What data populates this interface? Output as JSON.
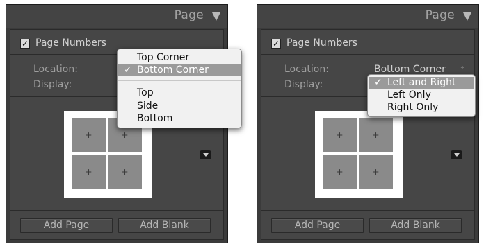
{
  "left": {
    "panel_title": "Page",
    "page_numbers_label": "Page Numbers",
    "page_numbers_checked": "✓",
    "location_label": "Location:",
    "display_label": "Display:",
    "location_menu": {
      "items": [
        {
          "label": "Top Corner",
          "check": ""
        },
        {
          "label": "Bottom Corner",
          "check": "✓"
        },
        {
          "label": "Top",
          "check": ""
        },
        {
          "label": "Side",
          "check": ""
        },
        {
          "label": "Bottom",
          "check": ""
        }
      ]
    },
    "grid_cells": [
      "+",
      "+",
      "+",
      "+"
    ],
    "add_page_label": "Add Page",
    "add_blank_label": "Add Blank"
  },
  "right": {
    "panel_title": "Page",
    "page_numbers_label": "Page Numbers",
    "page_numbers_checked": "✓",
    "location_label": "Location:",
    "display_label": "Display:",
    "location_value": "Bottom Corner",
    "location_arrows": "÷",
    "display_menu": {
      "items": [
        {
          "label": "Left and Right",
          "check": "✓"
        },
        {
          "label": "Left Only",
          "check": ""
        },
        {
          "label": "Right Only",
          "check": ""
        }
      ]
    },
    "grid_cells": [
      "+",
      "+",
      "+",
      "+"
    ],
    "add_page_label": "Add Page",
    "add_blank_label": "Add Blank"
  },
  "colors": {
    "panel_bg": "#3b3b3b",
    "menu_bg": "#f1f1f1",
    "menu_selected": "#9a9a9a"
  },
  "icons": {
    "collapse": "triangle-down-icon",
    "checkbox": "checkmark-icon",
    "mini_button": "dropdown-arrow-icon",
    "select_arrows": "updown-arrows-icon"
  }
}
